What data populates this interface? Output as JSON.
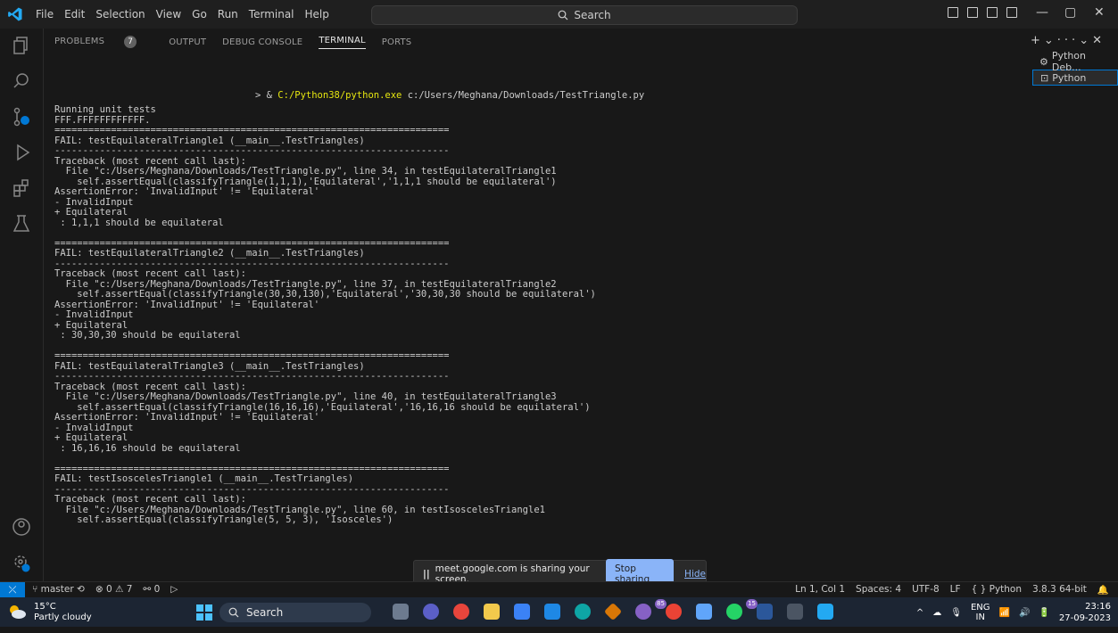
{
  "menu": [
    "File",
    "Edit",
    "Selection",
    "View",
    "Go",
    "Run",
    "Terminal",
    "Help"
  ],
  "search": {
    "label": "Search"
  },
  "panel": {
    "tabs": [
      "PROBLEMS",
      "OUTPUT",
      "DEBUG CONSOLE",
      "TERMINAL",
      "PORTS"
    ],
    "problems_count": "7"
  },
  "terminal": {
    "prompt_prefix": "> & ",
    "exe": "C:/Python38/python.exe",
    "script": " c:/Users/Meghana/Downloads/TestTriangle.py",
    "output": "Running unit tests\nFFF.FFFFFFFFFFFF.\n======================================================================\nFAIL: testEquilateralTriangle1 (__main__.TestTriangles)\n----------------------------------------------------------------------\nTraceback (most recent call last):\n  File \"c:/Users/Meghana/Downloads/TestTriangle.py\", line 34, in testEquilateralTriangle1\n    self.assertEqual(classifyTriangle(1,1,1),'Equilateral','1,1,1 should be equilateral')\nAssertionError: 'InvalidInput' != 'Equilateral'\n- InvalidInput\n+ Equilateral\n : 1,1,1 should be equilateral\n\n======================================================================\nFAIL: testEquilateralTriangle2 (__main__.TestTriangles)\n----------------------------------------------------------------------\nTraceback (most recent call last):\n  File \"c:/Users/Meghana/Downloads/TestTriangle.py\", line 37, in testEquilateralTriangle2\n    self.assertEqual(classifyTriangle(30,30,130),'Equilateral','30,30,30 should be equilateral')\nAssertionError: 'InvalidInput' != 'Equilateral'\n- InvalidInput\n+ Equilateral\n : 30,30,30 should be equilateral\n\n======================================================================\nFAIL: testEquilateralTriangle3 (__main__.TestTriangles)\n----------------------------------------------------------------------\nTraceback (most recent call last):\n  File \"c:/Users/Meghana/Downloads/TestTriangle.py\", line 40, in testEquilateralTriangle3\n    self.assertEqual(classifyTriangle(16,16,16),'Equilateral','16,16,16 should be equilateral')\nAssertionError: 'InvalidInput' != 'Equilateral'\n- InvalidInput\n+ Equilateral\n : 16,16,16 should be equilateral\n\n======================================================================\nFAIL: testIsoscelesTriangle1 (__main__.TestTriangles)\n----------------------------------------------------------------------\nTraceback (most recent call last):\n  File \"c:/Users/Meghana/Downloads/TestTriangle.py\", line 60, in testIsoscelesTriangle1\n    self.assertEqual(classifyTriangle(5, 5, 3), 'Isosceles')"
  },
  "terminal_list": [
    "Python Deb...",
    "Python"
  ],
  "status": {
    "branch": "master",
    "errors": "0",
    "warnings": "7",
    "ports": "0",
    "position": "Ln 1, Col 1",
    "spaces": "Spaces: 4",
    "encoding": "UTF-8",
    "eol": "LF",
    "language": "Python",
    "interpreter": "3.8.3 64-bit"
  },
  "share": {
    "text": "meet.google.com is sharing your screen.",
    "stop": "Stop sharing",
    "hide": "Hide"
  },
  "taskbar": {
    "temp": "15°C",
    "weather": "Partly cloudy",
    "search": "Search",
    "lang1": "ENG",
    "lang2": "IN",
    "time": "23:16",
    "date": "27-09-2023",
    "badge1": "85",
    "badge2": "15"
  },
  "colors": {
    "accent": "#0078d4",
    "exe": "#e5e510"
  }
}
